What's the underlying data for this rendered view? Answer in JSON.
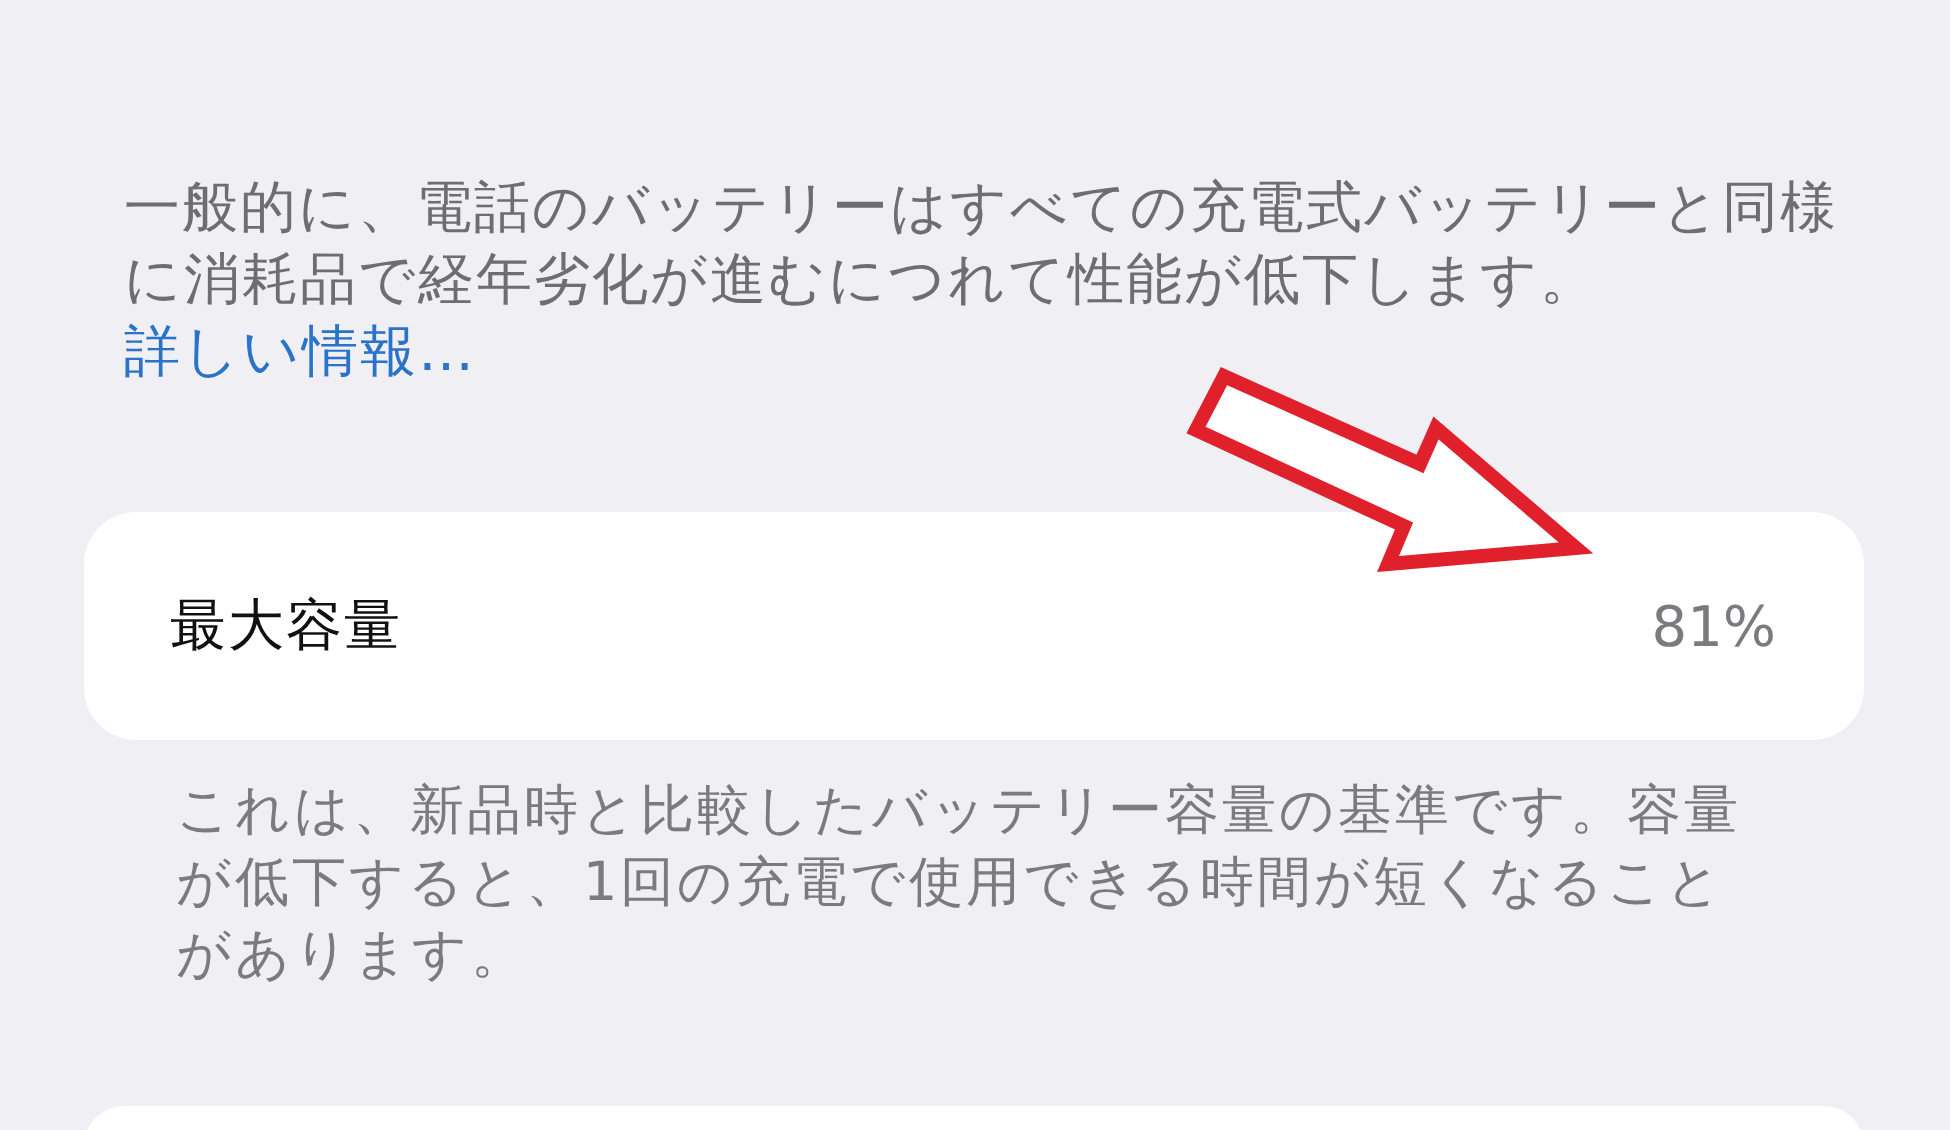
{
  "description": {
    "text": "一般的に、電話のバッテリーはすべての充電式バッテリーと同様に消耗品で経年劣化が進むにつれて性能が低下します。",
    "link": "詳しい情報…"
  },
  "capacity": {
    "label": "最大容量",
    "value": "81%"
  },
  "footnote": "これは、新品時と比較したバッテリー容量の基準です。容量が低下すると、1回の充電で使用できる時間が短くなることがあります。"
}
